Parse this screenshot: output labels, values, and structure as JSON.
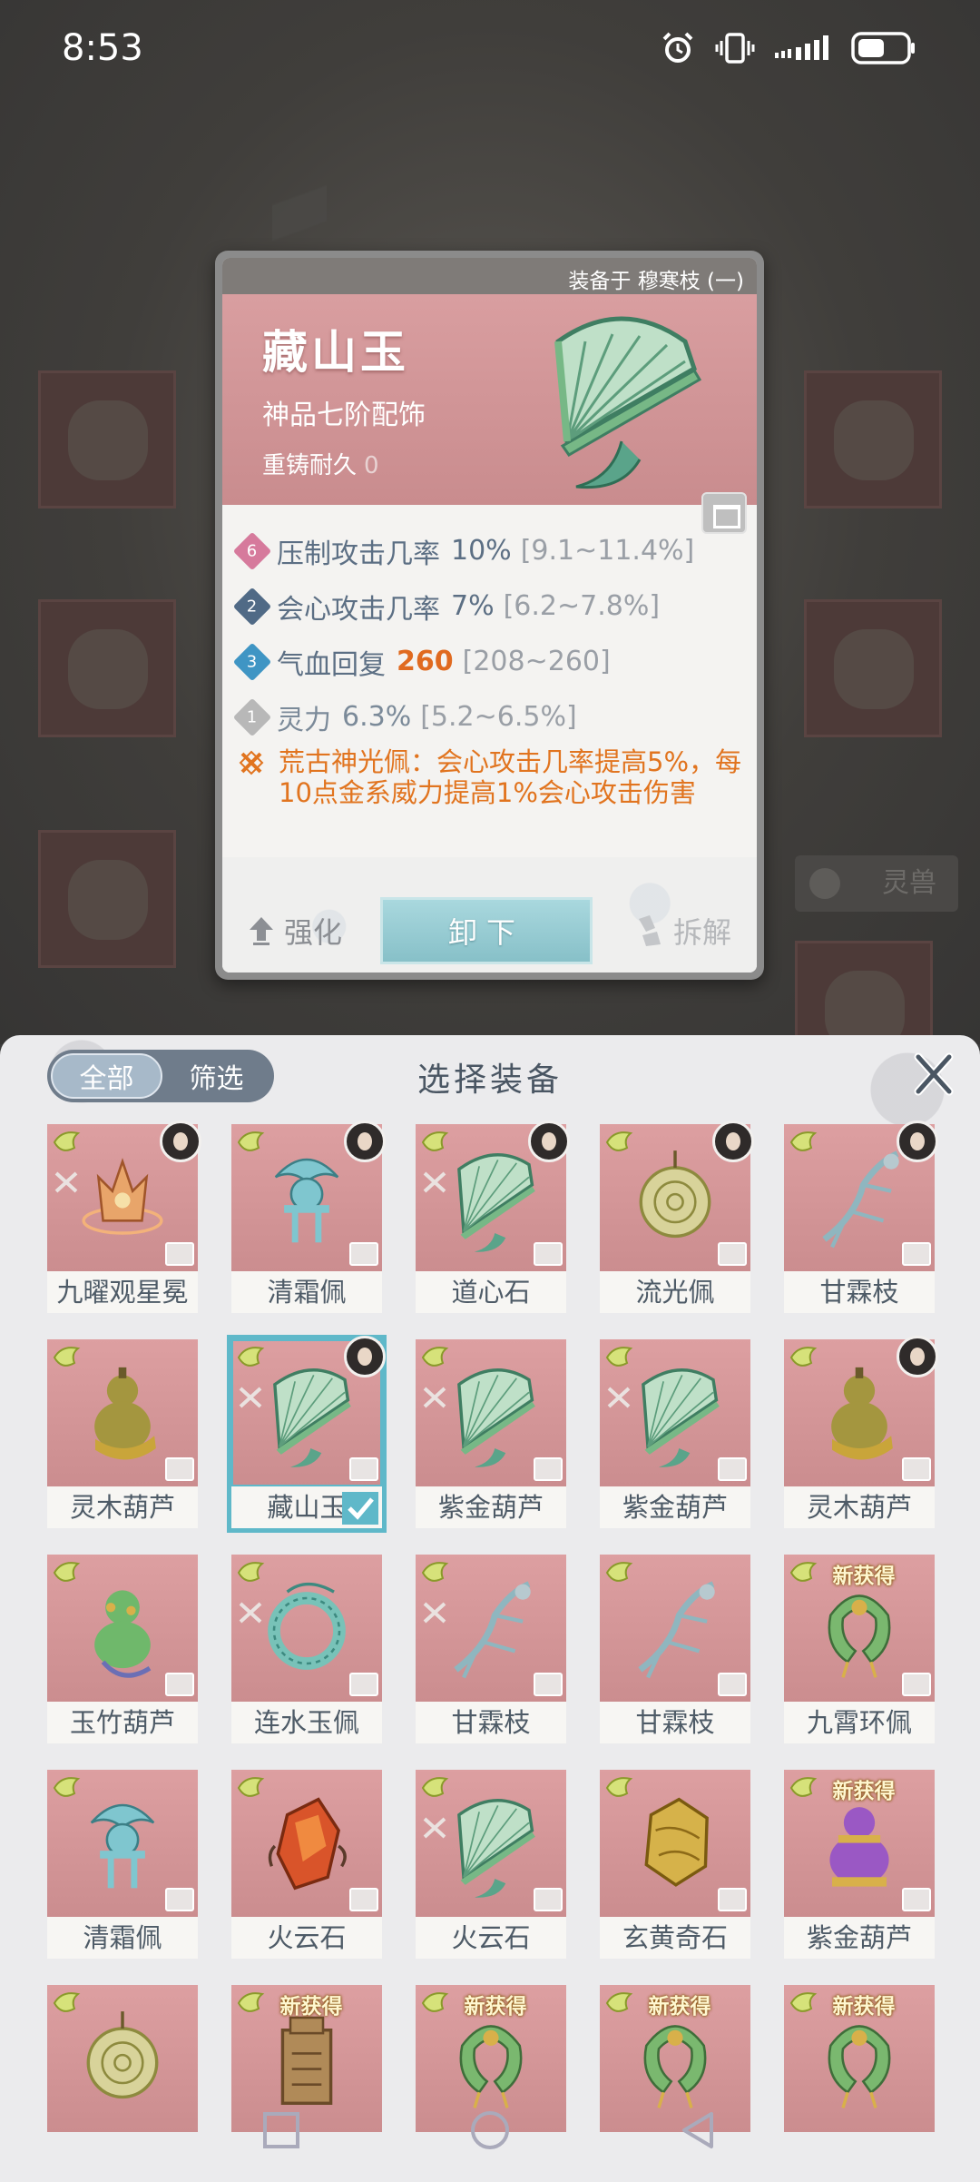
{
  "status_bar": {
    "time": "8:53"
  },
  "background": {
    "tab_label": "灵兽"
  },
  "detail": {
    "equipped_on": "装备于 穆寒枝 (一)",
    "name": "藏山玉",
    "grade": "神品七阶配饰",
    "durability_label": "重铸耐久",
    "durability_value": "0",
    "stats": [
      {
        "rank": "6",
        "name": "压制攻击几率",
        "value": "10%",
        "range": "[9.1~11.4%]"
      },
      {
        "rank": "2",
        "name": "会心攻击几率",
        "value": "7%",
        "range": "[6.2~7.8%]"
      },
      {
        "rank": "3",
        "name": "气血回复",
        "value": "260",
        "range": "[208~260]"
      },
      {
        "rank": "1",
        "name": "灵力",
        "value": "6.3%",
        "range": "[5.2~6.5%]"
      }
    ],
    "effect": "荒古神光佩：会心攻击几率提高5%，每10点金系威力提高1%会心攻击伤害",
    "buttons": {
      "strengthen": "强化",
      "unequip": "卸下",
      "dismantle": "拆解"
    }
  },
  "sheet": {
    "title": "选择装备",
    "filter_all": "全部",
    "filter_screen": "筛选",
    "new_tag": "新获得",
    "items": [
      {
        "name": "九曜观星冕",
        "icon": "crown-icon",
        "color": "#e8a56a"
      },
      {
        "name": "清霜佩",
        "icon": "jade-pendant-icon",
        "color": "#7fc6cf"
      },
      {
        "name": "道心石",
        "icon": "fan-icon",
        "color": "#a8cfb0"
      },
      {
        "name": "流光佩",
        "icon": "disc-pendant-icon",
        "color": "#d8d39a"
      },
      {
        "name": "甘霖枝",
        "icon": "branch-icon",
        "color": "#8fb6bf"
      },
      {
        "name": "灵木葫芦",
        "icon": "gourd-icon",
        "color": "#a4963f"
      },
      {
        "name": "藏山玉",
        "icon": "fan-icon",
        "color": "#a8cfb0"
      },
      {
        "name": "紫金葫芦",
        "icon": "fan-icon",
        "color": "#a8cfb0"
      },
      {
        "name": "紫金葫芦",
        "icon": "fan-icon",
        "color": "#a8cfb0"
      },
      {
        "name": "灵木葫芦",
        "icon": "gourd-icon",
        "color": "#a4963f"
      },
      {
        "name": "玉竹葫芦",
        "icon": "green-gourd-icon",
        "color": "#6fb86b"
      },
      {
        "name": "连水玉佩",
        "icon": "ring-pendant-icon",
        "color": "#78c2b8"
      },
      {
        "name": "甘霖枝",
        "icon": "branch-icon",
        "color": "#8fb6bf"
      },
      {
        "name": "甘霖枝",
        "icon": "branch-icon",
        "color": "#8fb6bf"
      },
      {
        "name": "九霄环佩",
        "icon": "horseshoe-icon",
        "color": "#7ab86f"
      },
      {
        "name": "清霜佩",
        "icon": "jade-pendant-icon",
        "color": "#7fc6cf"
      },
      {
        "name": "火云石",
        "icon": "fire-stone-icon",
        "color": "#d9542a"
      },
      {
        "name": "火云石",
        "icon": "fan-icon",
        "color": "#a8cfb0"
      },
      {
        "name": "玄黄奇石",
        "icon": "gold-stone-icon",
        "color": "#d6b24a"
      },
      {
        "name": "紫金葫芦",
        "icon": "purple-gourd-icon",
        "color": "#9a58c4"
      },
      {
        "name": "",
        "icon": "disc-pendant-icon",
        "color": "#d8d39a"
      },
      {
        "name": "",
        "icon": "seal-icon",
        "color": "#b08a58"
      },
      {
        "name": "",
        "icon": "horseshoe-icon",
        "color": "#7ab86f"
      },
      {
        "name": "",
        "icon": "horseshoe-icon",
        "color": "#7ab86f"
      },
      {
        "name": "",
        "icon": "horseshoe-icon",
        "color": "#7ab86f"
      }
    ]
  }
}
